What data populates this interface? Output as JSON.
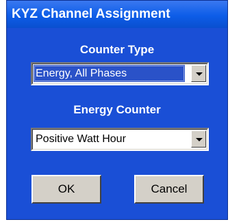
{
  "window": {
    "title": "KYZ Channel Assignment"
  },
  "counter_type": {
    "label": "Counter Type",
    "selected": "Energy, All Phases"
  },
  "energy_counter": {
    "label": "Energy Counter",
    "selected": "Positive Watt Hour"
  },
  "buttons": {
    "ok_label": "OK",
    "cancel_label": "Cancel"
  },
  "colors": {
    "dialog_background": "#1a4fd6",
    "titlebar": "#0d5de8",
    "selection_highlight": "#2a52c8",
    "button_face": "#d4d0c8"
  }
}
